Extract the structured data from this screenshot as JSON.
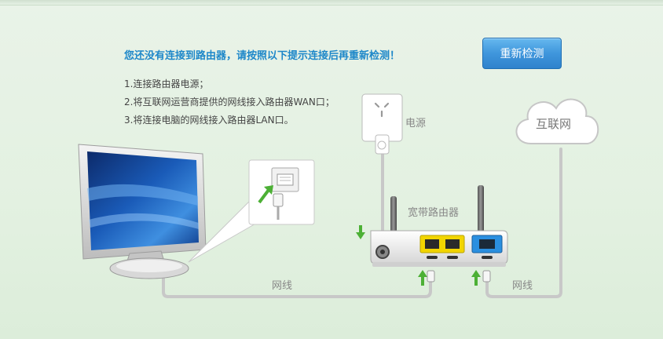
{
  "warning": "您还没有连接到路由器，请按照以下提示连接后再重新检测！",
  "steps": [
    "1.连接路由器电源；",
    "2.将互联网运营商提供的网线接入路由器WAN口；",
    "3.将连接电脑的网线接入路由器LAN口。"
  ],
  "recheck_button": "重新检测",
  "labels": {
    "power": "电源",
    "internet": "互联网",
    "router": "宽带路由器",
    "cable_left": "网线",
    "cable_right": "网线"
  },
  "colors": {
    "accent_blue": "#1d87c9",
    "arrow_green": "#4cb035",
    "lan_yellow": "#f2d500",
    "wan_blue": "#2b8fe0"
  }
}
